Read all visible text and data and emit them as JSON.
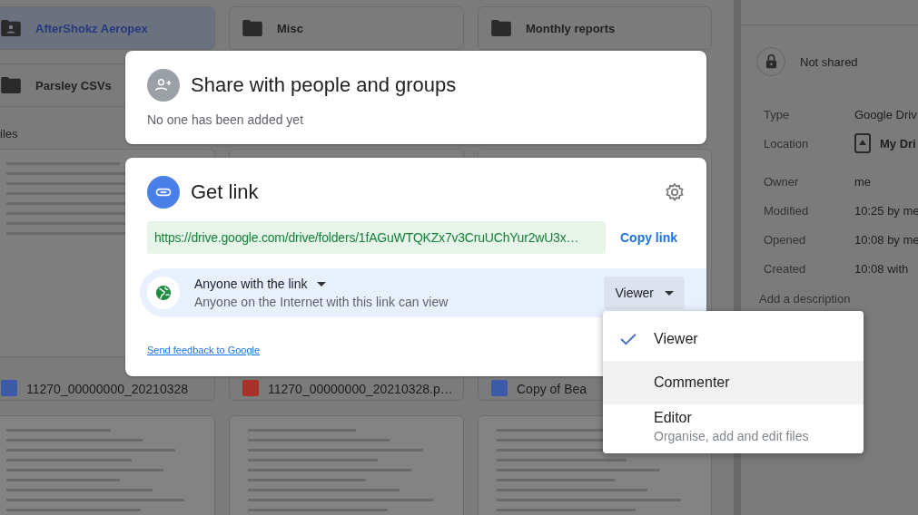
{
  "drive": {
    "folders": [
      {
        "name": "AfterShokz Aeropex",
        "kind": "shared",
        "selected": true
      },
      {
        "name": "Misc",
        "kind": "folder",
        "selected": false
      },
      {
        "name": "Monthly reports",
        "kind": "folder",
        "selected": false
      },
      {
        "name": "Parsley CSVs",
        "kind": "folder",
        "selected": false
      }
    ],
    "files_heading": "iles",
    "files": [
      {
        "name": "11270_00000000_20210328",
        "kind": "doc"
      },
      {
        "name": "11270_00000000_20210328.p…",
        "kind": "pdf"
      },
      {
        "name": "Copy of Bea",
        "kind": "doc"
      }
    ]
  },
  "details": {
    "sharing": "Not shared",
    "rows": [
      {
        "label": "Type",
        "value": "Google Driv",
        "kind": "text"
      },
      {
        "label": "Location",
        "value": "My Dri",
        "kind": "drive"
      },
      {
        "label": "Owner",
        "value": "me",
        "kind": "text"
      },
      {
        "label": "Modified",
        "value": "10:25 by me",
        "kind": "text"
      },
      {
        "label": "Opened",
        "value": "10:08 by me",
        "kind": "text"
      },
      {
        "label": "Created",
        "value": "10:08 with",
        "kind": "text"
      }
    ],
    "description": "Add a description"
  },
  "share": {
    "title": "Share with people and groups",
    "subtitle": "No one has been added yet"
  },
  "link": {
    "title": "Get link",
    "url": "https://drive.google.com/drive/folders/1fAGuWTQKZx7v3CruUChYur2wU3x…",
    "copy": "Copy link",
    "access_label": "Anyone with the link",
    "access_description": "Anyone on the Internet with this link can view",
    "role": "Viewer",
    "feedback": "Send feedback to Google"
  },
  "role_menu": [
    {
      "label": "Viewer",
      "selected": true,
      "hovered": false
    },
    {
      "label": "Commenter",
      "selected": false,
      "hovered": true
    },
    {
      "label": "Editor",
      "description": "Organise, add and edit files",
      "selected": false,
      "hovered": false
    }
  ]
}
